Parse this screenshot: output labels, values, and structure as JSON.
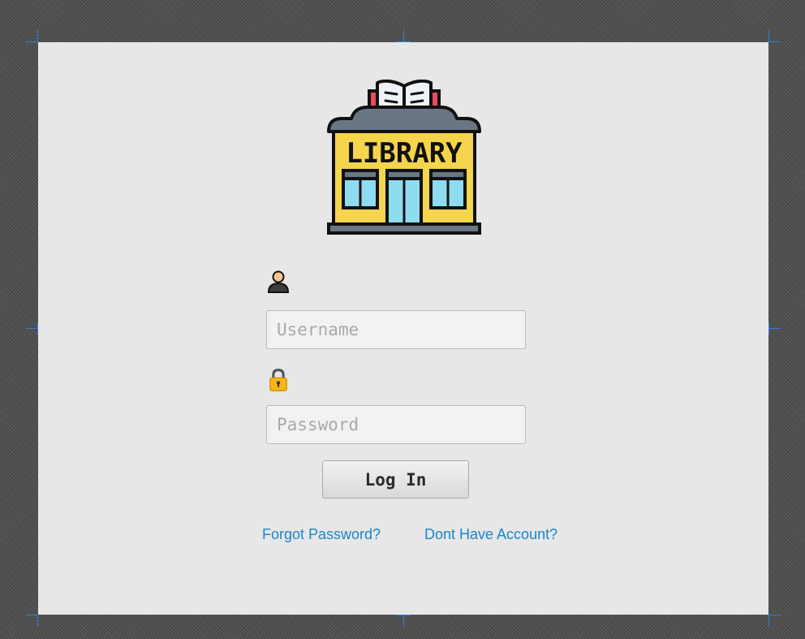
{
  "logo": {
    "icon": "library-building-icon",
    "sign_text": "LIBRARY"
  },
  "username": {
    "icon": "user-icon",
    "placeholder": "Username",
    "value": ""
  },
  "password": {
    "icon": "lock-icon",
    "placeholder": "Password",
    "value": ""
  },
  "login_button": {
    "label": "Log In"
  },
  "links": {
    "forgot_password": "Forgot Password?",
    "no_account": "Dont Have Account?"
  },
  "colors": {
    "canvas_bg": "#e7e7e7",
    "link": "#1a86c8",
    "guide_marks": "#2f7fe0",
    "library_wall": "#f5d44e",
    "library_roof": "#6b7685",
    "library_window": "#8ddcf0",
    "library_banner": "#e94b5f",
    "lock_body": "#f7b718"
  }
}
